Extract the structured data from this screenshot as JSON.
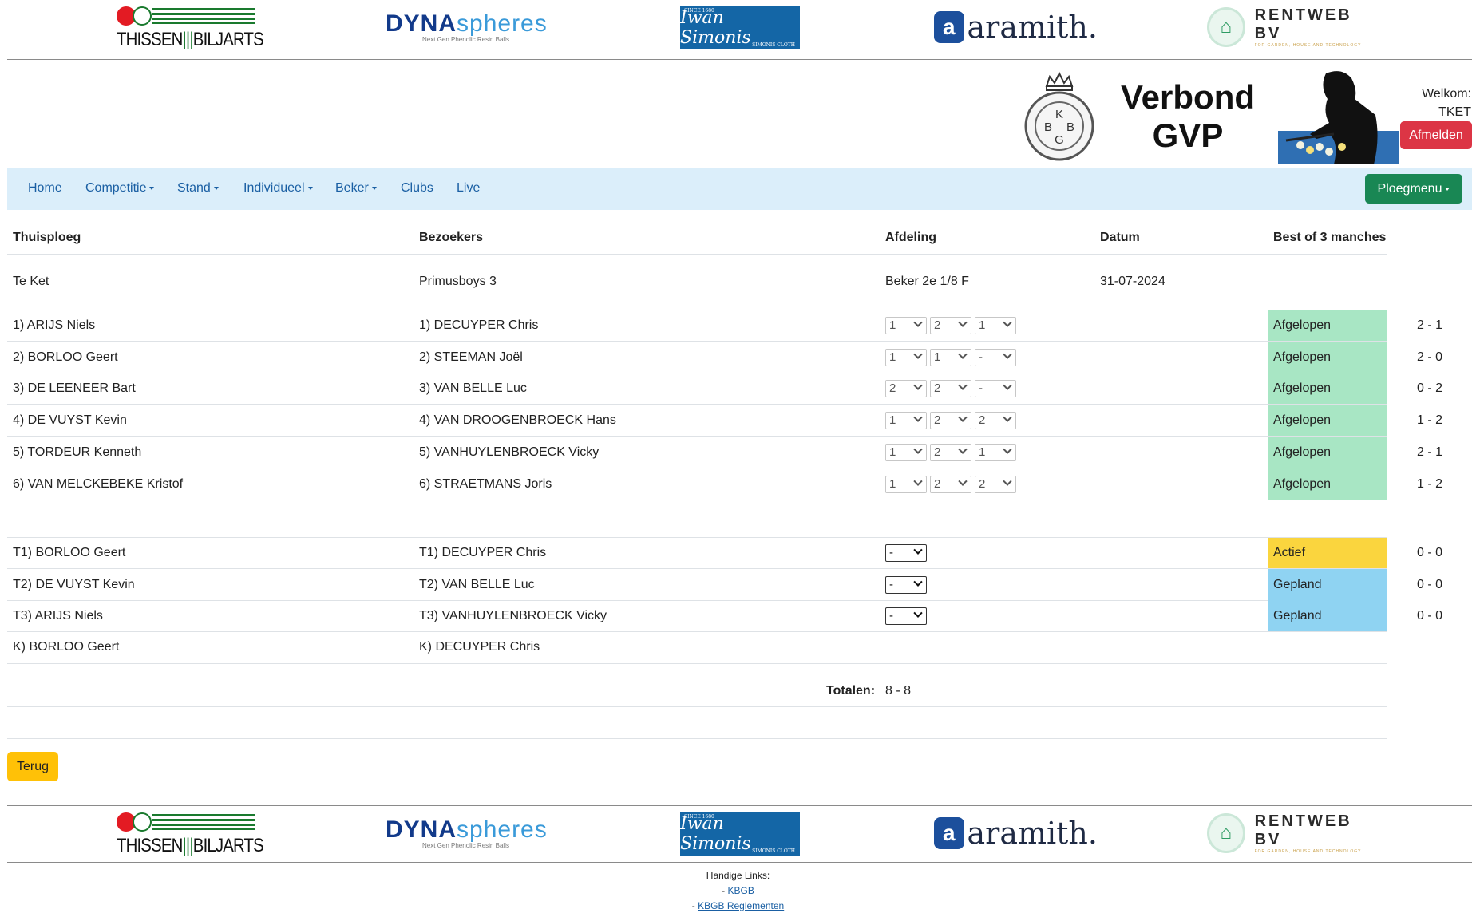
{
  "sponsors": {
    "thissen": "THISSEN",
    "thissen_b": "BILJARTS",
    "dyna_main": "DYNA",
    "dyna_sub": "spheres",
    "dyna_tag": "Next Gen Phenolic Resin Balls",
    "simonis_since": "SINCE 1680",
    "simonis_sign": "Iwan Simonis",
    "simonis_cloth": "SIMONIS CLOTH",
    "aramith": "aramith.",
    "rentweb": "RENTWEB BV",
    "rentweb_tag": "FOR GARDEN, HOUSE AND TECHNOLOGY"
  },
  "header": {
    "title_line1": "Verbond",
    "title_line2": "GVP",
    "seal_letters": [
      "K",
      "B",
      "B",
      "G"
    ],
    "welcome_label": "Welkom:",
    "username": "TKET",
    "logout_label": "Afmelden"
  },
  "nav": {
    "home": "Home",
    "competitie": "Competitie",
    "stand": "Stand",
    "individueel": "Individueel",
    "beker": "Beker",
    "clubs": "Clubs",
    "live": "Live",
    "ploegmenu": "Ploegmenu"
  },
  "table": {
    "headers": {
      "home": "Thuisploeg",
      "away": "Bezoekers",
      "division": "Afdeling",
      "date": "Datum",
      "format": "Best of 3 manches"
    },
    "match": {
      "home": "Te Ket",
      "away": "Primusboys 3",
      "division": "Beker 2e 1/8 F",
      "date": "31-07-2024"
    },
    "games": [
      {
        "home": "1) ARIJS Niels",
        "away": "1) DECUYPER Chris",
        "sets": [
          "1",
          "2",
          "1"
        ],
        "status": "Afgelopen",
        "score": "2 - 1"
      },
      {
        "home": "2) BORLOO Geert",
        "away": "2) STEEMAN Joël",
        "sets": [
          "1",
          "1",
          "-"
        ],
        "status": "Afgelopen",
        "score": "2 - 0"
      },
      {
        "home": "3) DE LEENEER Bart",
        "away": "3) VAN BELLE Luc",
        "sets": [
          "2",
          "2",
          "-"
        ],
        "status": "Afgelopen",
        "score": "0 - 2"
      },
      {
        "home": "4) DE VUYST Kevin",
        "away": "4) VAN DROOGENBROECK Hans",
        "sets": [
          "1",
          "2",
          "2"
        ],
        "status": "Afgelopen",
        "score": "1 - 2"
      },
      {
        "home": "5) TORDEUR Kenneth",
        "away": "5) VANHUYLENBROECK Vicky",
        "sets": [
          "1",
          "2",
          "1"
        ],
        "status": "Afgelopen",
        "score": "2 - 1"
      },
      {
        "home": "6) VAN MELCKEBEKE Kristof",
        "away": "6) STRAETMANS Joris",
        "sets": [
          "1",
          "2",
          "2"
        ],
        "status": "Afgelopen",
        "score": "1 - 2"
      }
    ],
    "tiebreaks": [
      {
        "home": "T1) BORLOO Geert",
        "away": "T1) DECUYPER Chris",
        "set": "-",
        "status": "Actief",
        "score": "0 - 0"
      },
      {
        "home": "T2) DE VUYST Kevin",
        "away": "T2) VAN BELLE Luc",
        "set": "-",
        "status": "Gepland",
        "score": "0 - 0"
      },
      {
        "home": "T3) ARIJS Niels",
        "away": "T3) VANHUYLENBROECK Vicky",
        "set": "-",
        "status": "Gepland",
        "score": "0 - 0"
      }
    ],
    "captains": {
      "home": "K) BORLOO Geert",
      "away": "K) DECUYPER Chris"
    },
    "totals_label": "Totalen:",
    "totals_value": "8 - 8"
  },
  "status_colors": {
    "Afgelopen": "#a8e6c4",
    "Actief": "#fad53e",
    "Gepland": "#8fd3f2"
  },
  "back_label": "Terug",
  "footer": {
    "title": "Handige Links:",
    "links": [
      "KBGB",
      "KBGB Reglementen"
    ]
  }
}
